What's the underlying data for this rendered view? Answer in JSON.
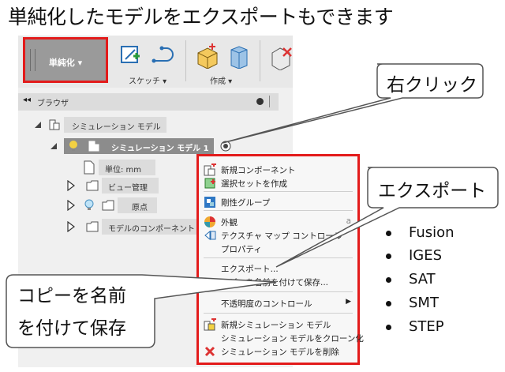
{
  "page_title": "単純化したモデルをエクスポートもできます",
  "toolbar": {
    "simplify_label": "単純化 ▾",
    "sketch_label": "スケッチ ▾",
    "create_label": "作成 ▾"
  },
  "browser": {
    "title": "ブラウザ",
    "collapse_glyph": "◂◂",
    "rows": [
      {
        "label": "シミュレーション モデル"
      },
      {
        "label": "シミュレーション モデル 1"
      },
      {
        "label": "単位: mm"
      },
      {
        "label": "ビュー管理"
      },
      {
        "label": "原点"
      },
      {
        "label": "モデルのコンポーネント"
      }
    ]
  },
  "context_menu": {
    "items": [
      {
        "label": "新規コンポーネント",
        "icon": "new-component-icon"
      },
      {
        "label": "選択セットを作成",
        "icon": "selection-set-icon"
      },
      {
        "label": "剛性グループ",
        "icon": "rigid-group-icon"
      },
      {
        "label": "外観",
        "icon": "appearance-icon",
        "shortcut": "a"
      },
      {
        "label": "テクスチャ マップ コントロール",
        "icon": "texture-map-icon"
      },
      {
        "label": "プロパティ",
        "icon": ""
      },
      {
        "label": "エクスポート...",
        "icon": ""
      },
      {
        "label": "コピーを名前を付けて保存...",
        "icon": ""
      },
      {
        "label": "不透明度のコントロール",
        "icon": "",
        "submenu": "▶"
      },
      {
        "label": "新規シミュレーション モデル",
        "icon": "new-sim-model-icon"
      },
      {
        "label": "シミュレーション モデルをクローン化",
        "icon": ""
      },
      {
        "label": "シミュレーション モデルを削除",
        "icon": "delete-icon"
      }
    ]
  },
  "callouts": {
    "right_click": "右クリック",
    "export": "エクスポート",
    "save_copy_line1": "コピーを名前",
    "save_copy_line2": "を付けて保存"
  },
  "export_formats": [
    "Fusion",
    "IGES",
    "SAT",
    "SMT",
    "STEP"
  ],
  "colors": {
    "highlight_red": "#e31b1b",
    "callout_border": "#555555",
    "toolbar_bg": "#e8e8e8",
    "simplify_bg": "#9a9a9a",
    "menu_bg": "#f7f7f7"
  }
}
